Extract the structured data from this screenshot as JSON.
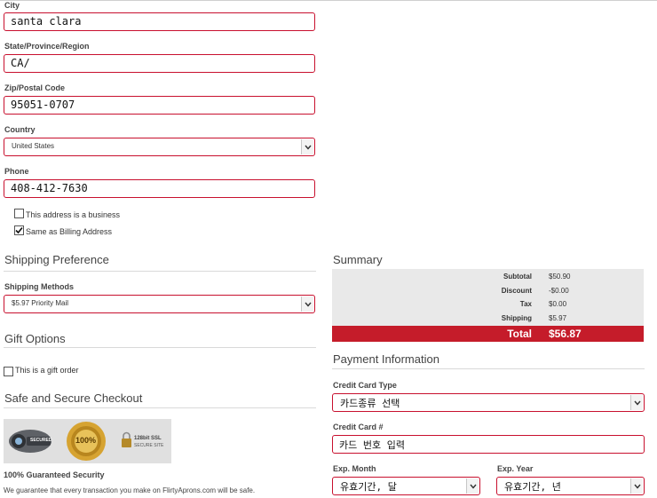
{
  "address": {
    "city": {
      "label": "City",
      "value": "santa clara"
    },
    "state": {
      "label": "State/Province/Region",
      "value": "CA/"
    },
    "zip": {
      "label": "Zip/Postal Code",
      "value": "95051-0707"
    },
    "country": {
      "label": "Country",
      "value": "United States"
    },
    "phone": {
      "label": "Phone",
      "value": "408-412-7630"
    },
    "business_checkbox": {
      "label": "This address is a business",
      "checked": false
    },
    "same_billing_checkbox": {
      "label": "Same as Billing Address",
      "checked": true
    }
  },
  "shipping": {
    "heading": "Shipping Preference",
    "methods_label": "Shipping Methods",
    "method_value": "$5.97 Priority Mail"
  },
  "gift": {
    "heading": "Gift Options",
    "checkbox_label": "This is a gift order",
    "checked": false
  },
  "secure": {
    "heading": "Safe and Secure Checkout",
    "guarantee_title": "100% Guaranteed Security",
    "guarantee_text": "We guarantee that every transaction you make on FlirtyAprons.com will be safe.",
    "badge_secured": "SECURED",
    "badge_100": "100%",
    "badge_ssl_line1": "128bit SSL",
    "badge_ssl_line2": "SECURE SITE"
  },
  "summary": {
    "heading": "Summary",
    "rows": [
      {
        "label": "Subtotal",
        "value": "$50.90"
      },
      {
        "label": "Discount",
        "value": "-$0.00"
      },
      {
        "label": "Tax",
        "value": "$0.00"
      },
      {
        "label": "Shipping",
        "value": "$5.97"
      }
    ],
    "total_label": "Total",
    "total_value": "$56.87",
    "total_color": "#c51c2a"
  },
  "payment": {
    "heading": "Payment Information",
    "card_type_label": "Credit Card Type",
    "card_type_value": "카드종류 선택",
    "card_number_label": "Credit Card #",
    "card_number_value": "카드 번호 입력",
    "exp_month_label": "Exp. Month",
    "exp_month_value": "유효기간, 달",
    "exp_year_label": "Exp. Year",
    "exp_year_value": "유효기간, 년"
  },
  "colors": {
    "accent": "#c8102e",
    "summary_bg": "#e9e9e9"
  }
}
